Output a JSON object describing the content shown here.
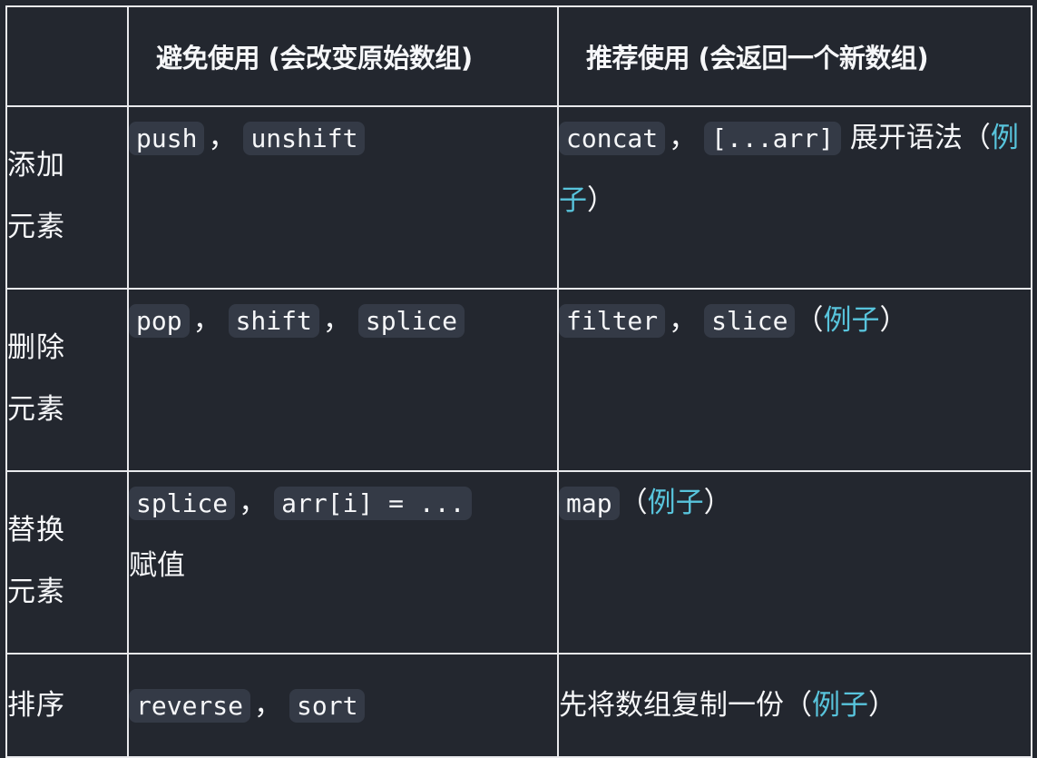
{
  "header": {
    "col2": "避免使用 (会改变原始数组)",
    "col3": "推荐使用 (会返回一个新数组)"
  },
  "rows": [
    {
      "label_line1": "添加",
      "label_line2": "元素",
      "avoid": [
        "push",
        "unshift"
      ],
      "prefer": [
        "concat",
        "[...arr]"
      ],
      "prefer_suffix": "展开语法",
      "example_link": "例子"
    },
    {
      "label_line1": "删除",
      "label_line2": "元素",
      "avoid": [
        "pop",
        "shift",
        "splice"
      ],
      "prefer": [
        "filter",
        "slice"
      ],
      "example_link": "例子"
    },
    {
      "label_line1": "替换",
      "label_line2": "元素",
      "avoid": [
        "splice",
        "arr[i] = ..."
      ],
      "avoid_suffix": "赋值",
      "prefer": [
        "map"
      ],
      "example_link": "例子"
    },
    {
      "label_line1": "排序",
      "avoid": [
        "reverse",
        "sort"
      ],
      "prefer_text": "先将数组复制一份",
      "example_link": "例子"
    }
  ],
  "punct": {
    "comma": "，",
    "open_paren": "（",
    "close_paren": "）"
  },
  "colors": {
    "background": "#23272f",
    "border": "#e8e9ec",
    "code_bg": "#343a46",
    "link": "#58c4dc",
    "text": "#f6f7f9"
  }
}
